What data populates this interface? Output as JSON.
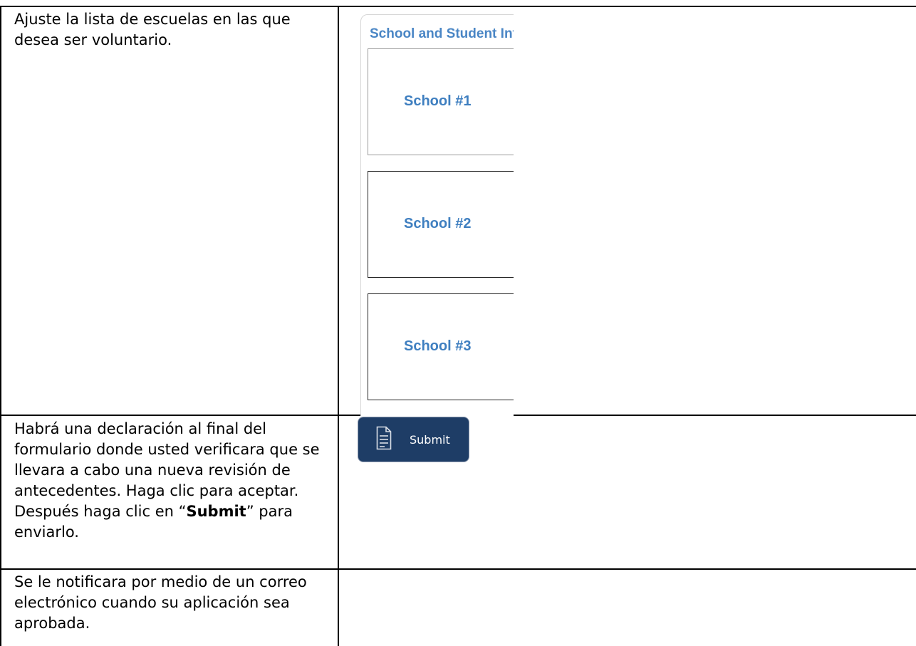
{
  "rows": [
    {
      "instruction": "Ajuste la lista de escuelas en las que desea ser voluntario."
    },
    {
      "instruction_pre": "Habrá una declaración al final del formulario donde usted verificara que se llevara a cabo una nueva revisión de antecedentes. Haga clic para aceptar. Después haga clic en “",
      "instruction_bold": "Submit",
      "instruction_post": "” para enviarlo."
    },
    {
      "instruction": "Se le notificara por medio de un correo electrónico cuando su aplicación sea aprobada."
    }
  ],
  "form": {
    "panel_title": "School and Student Information",
    "schools": [
      "School #1",
      "School #2",
      "School #3"
    ]
  },
  "submit_button": {
    "label": "Submit",
    "icon": "document-icon"
  },
  "colors": {
    "link_blue": "#4a86c5",
    "button_navy": "#1e3d66"
  }
}
